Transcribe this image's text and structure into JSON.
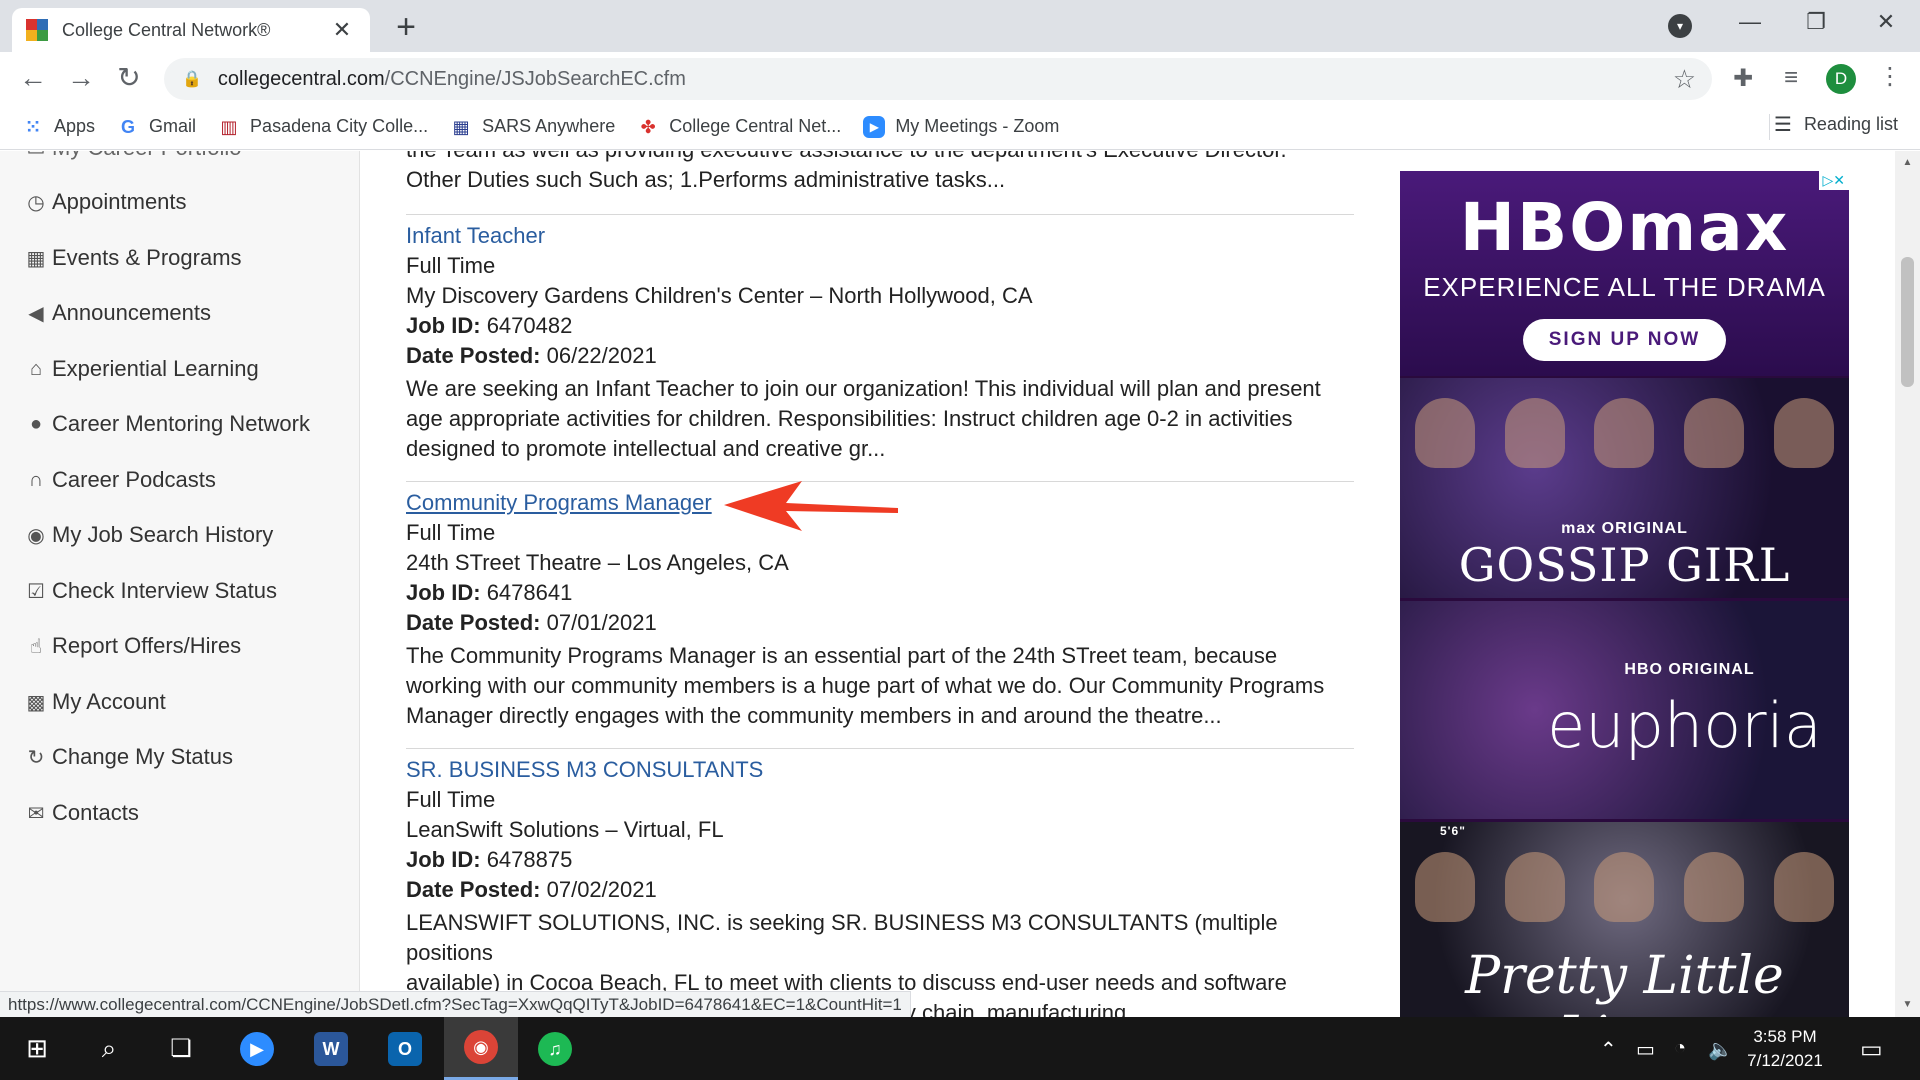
{
  "browser": {
    "tab_title": "College Central Network®",
    "tab_close": "✕",
    "new_tab": "+",
    "url_host": "collegecentral.com",
    "url_path": "/CCNEngine/JSJobSearchEC.cfm",
    "profile_initial": "D",
    "bookmarks": [
      {
        "label": "Apps",
        "icon": "apps-grid-icon"
      },
      {
        "label": "Gmail",
        "icon": "google-g-icon"
      },
      {
        "label": "Pasadena City Colle...",
        "icon": "pasadena-logo-icon"
      },
      {
        "label": "SARS Anywhere",
        "icon": "calendar-icon"
      },
      {
        "label": "College Central Net...",
        "icon": "ccn-logo-icon"
      },
      {
        "label": "My Meetings - Zoom",
        "icon": "zoom-icon"
      }
    ],
    "reading_list": "Reading list",
    "status_url": "https://www.collegecentral.com/CCNEngine/JobSDetl.cfm?SecTag=XxwQqQITyT&JobID=6478641&EC=1&CountHit=1"
  },
  "sidebar": {
    "partial_item": "My Career Portfolio",
    "items": [
      {
        "label": "Appointments",
        "icon": "clock-icon"
      },
      {
        "label": "Events & Programs",
        "icon": "calendar-icon"
      },
      {
        "label": "Announcements",
        "icon": "megaphone-icon"
      },
      {
        "label": "Experiential Learning",
        "icon": "graduation-cap-icon"
      },
      {
        "label": "Career Mentoring Network",
        "icon": "user-icon"
      },
      {
        "label": "Career Podcasts",
        "icon": "headphones-icon"
      },
      {
        "label": "My Job Search History",
        "icon": "eye-icon"
      },
      {
        "label": "Check Interview Status",
        "icon": "check-square-icon"
      },
      {
        "label": "Report Offers/Hires",
        "icon": "thumbs-up-icon"
      },
      {
        "label": "My Account",
        "icon": "account-icon"
      },
      {
        "label": "Change My Status",
        "icon": "refresh-icon"
      },
      {
        "label": "Contacts",
        "icon": "envelope-icon"
      }
    ]
  },
  "results": {
    "labels": {
      "job_id": "Job ID:",
      "date_posted": "Date Posted:"
    },
    "partial_top": {
      "line1": "the Team as well as providing executive assistance to the department's Executive Director.",
      "line2": "Other Duties such Such as; 1.Performs administrative tasks..."
    },
    "jobs": [
      {
        "title": "Infant Teacher",
        "type": "Full Time",
        "employer": "My Discovery Gardens Children's Center – North Hollywood, CA",
        "job_id": "6470482",
        "date_posted": "06/22/2021",
        "desc": [
          "We are seeking an Infant Teacher to join our organization! This individual will plan and present",
          "age appropriate activities for children. Responsibilities: Instruct children age 0-2 in activities",
          "designed to promote intellectual and creative gr..."
        ]
      },
      {
        "title": "Community Programs Manager",
        "type": "Full Time",
        "employer": "24th STreet Theatre – Los Angeles, CA",
        "job_id": "6478641",
        "date_posted": "07/01/2021",
        "desc": [
          "The Community Programs Manager is an essential part of the 24th STreet team, because",
          "working with our community members is a huge part of what we do. Our Community Programs",
          "Manager directly engages with the community members in and around the theatre..."
        ]
      },
      {
        "title": "SR. BUSINESS M3 CONSULTANTS",
        "type": "Full Time",
        "employer": "LeanSwift Solutions – Virtual, FL",
        "job_id": "6478875",
        "date_posted": "07/02/2021",
        "desc": [
          "LEANSWIFT SOLUTIONS, INC. is seeking SR. BUSINESS M3 CONSULTANTS (multiple positions",
          "available) in Cocoa Beach, FL to meet with clients to discuss end-user needs and software",
          "requirements to meet their business function (supply chain, manufacturing, ..."
        ]
      }
    ]
  },
  "ad": {
    "logo": "HBOmax",
    "tagline": "EXPERIENCE ALL THE DRAMA",
    "cta": "SIGN UP NOW",
    "badge": "▷✕",
    "show1_brand": "max ORIGINAL",
    "show1": "GOSSIP GIRL",
    "show2_brand": "HBO ORIGINAL",
    "show2": "euphoria",
    "show3_marker": "5'6\"",
    "show3": "Pretty Little Liars"
  },
  "taskbar": {
    "time": "3:58 PM",
    "date": "7/12/2021",
    "apps": [
      {
        "name": "zoom",
        "label": "▶",
        "color": "#2d8cff"
      },
      {
        "name": "word",
        "label": "W",
        "color": "#2b579a"
      },
      {
        "name": "outlook",
        "label": "O",
        "color": "#0a64ad"
      },
      {
        "name": "chrome",
        "label": "◉",
        "color": "#db4437"
      },
      {
        "name": "spotify",
        "label": "♫",
        "color": "#1db954"
      }
    ]
  }
}
